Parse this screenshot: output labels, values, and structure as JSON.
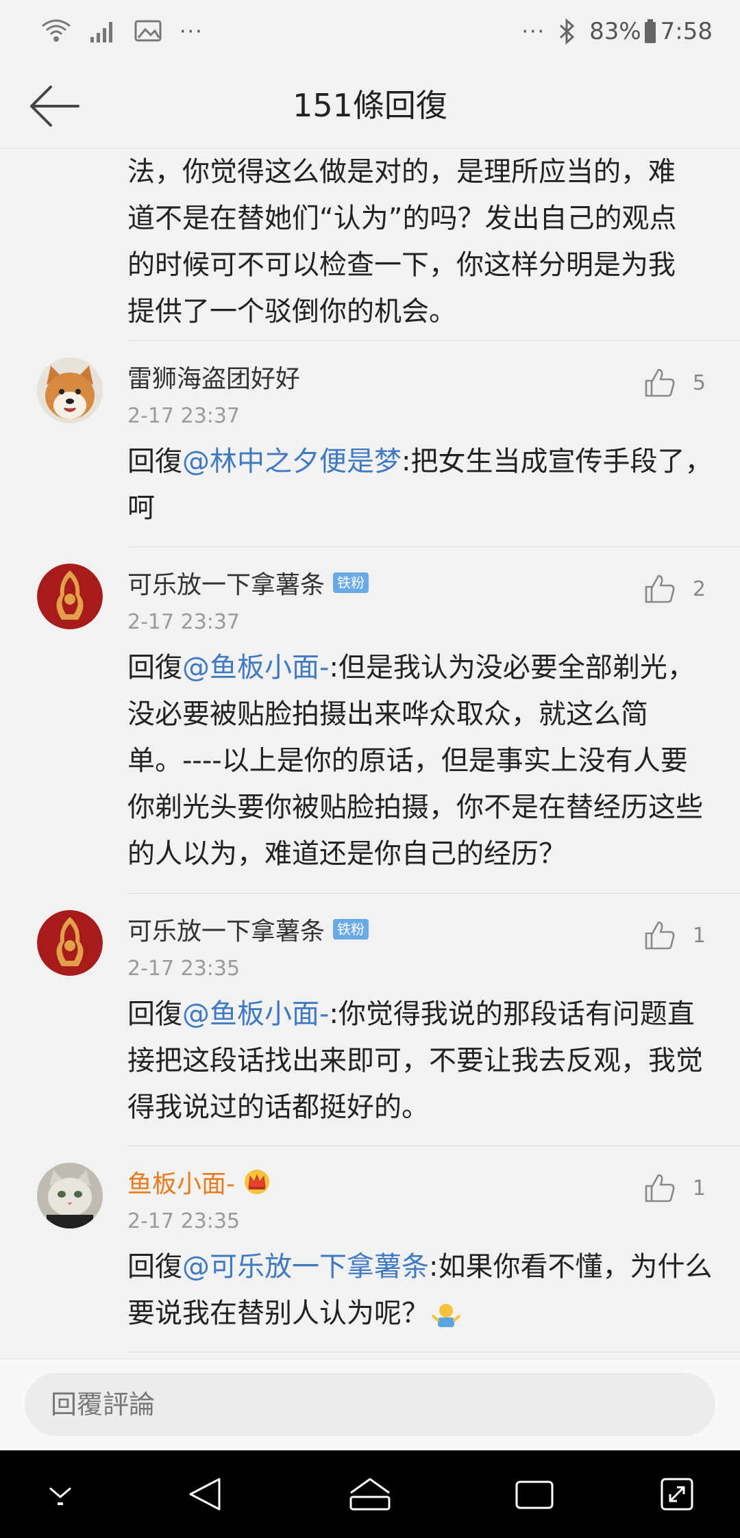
{
  "status_bar": {
    "battery": "83%",
    "time": "7:58",
    "dots": "···"
  },
  "header": {
    "title": "151條回復"
  },
  "partial_comment": {
    "lines": "法，你觉得这么做是对的，是理所应当的，难\n道不是在替她们“认为”的吗？发出自己的观点\n的时候可不可以检查一下，你这样分明是为我\n提供了一个驳倒你的机会。"
  },
  "comments": [
    {
      "username": "雷狮海盗团好好",
      "likes": "5",
      "time": "2-17 23:37",
      "reply_prefix": "回復",
      "mention": "@林中之夕便是梦",
      "text": ":把女生当成宣传手段了，呵"
    },
    {
      "username": "可乐放一下拿薯条",
      "badge": "铁粉",
      "likes": "2",
      "time": "2-17 23:37",
      "reply_prefix": "回復",
      "mention": "@鱼板小面-",
      "text": ":但是我认为没必要全部剃光，没必要被贴脸拍摄出来哗众取众，就这么简单。----以上是你的原话，但是事实上没有人要你剃光头要你被贴脸拍摄，你不是在替经历这些的人以为，难道还是你自己的经历？"
    },
    {
      "username": "可乐放一下拿薯条",
      "badge": "铁粉",
      "likes": "1",
      "time": "2-17 23:35",
      "reply_prefix": "回復",
      "mention": "@鱼板小面-",
      "text": ":你觉得我说的那段话有问题直接把这段话找出来即可，不要让我去反观，我觉得我说过的话都挺好的。"
    },
    {
      "username": "鱼板小面-",
      "likes": "1",
      "time": "2-17 23:35",
      "reply_prefix": "回復",
      "mention": "@可乐放一下拿薯条",
      "text": ":如果你看不懂，为什么要说我在替别人认为呢？"
    }
  ],
  "reply_bar": {
    "placeholder": "回覆評論"
  },
  "icons": {
    "back": "arrow-left-icon",
    "like": "thumbs-up-icon",
    "crown": "crown-icon",
    "shrug_emoji": "shrug-emoji-icon"
  },
  "colors": {
    "mention": "#3f79c2",
    "username_highlight": "#ea7a1e",
    "badge": "#68a9e6"
  }
}
